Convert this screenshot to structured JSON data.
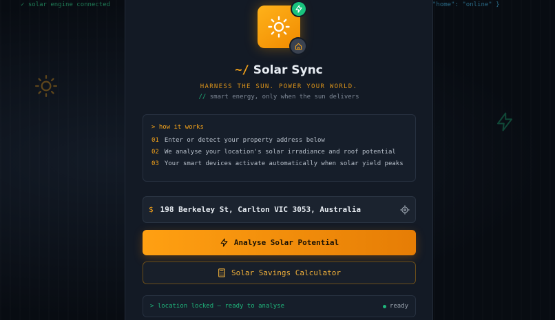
{
  "background": {
    "terminal_left": "✓ solar engine connected",
    "terminal_right": "\"home\": \"online\" }"
  },
  "header": {
    "prompt": "~/",
    "title": "Solar Sync",
    "tagline": "HARNESS THE SUN. POWER YOUR WORLD.",
    "subtag_prefix": "//",
    "subtag": "smart energy, only when the sun delivers"
  },
  "how_it_works": {
    "title": "> how it works",
    "steps": [
      {
        "num": "01",
        "text": "Enter or detect your property address below"
      },
      {
        "num": "02",
        "text": "We analyse your location's solar irradiance and roof potential"
      },
      {
        "num": "03",
        "text": "Your smart devices activate automatically when solar yield peaks"
      }
    ]
  },
  "address": {
    "prefix": "$",
    "value": "198 Berkeley St, Carlton VIC 3053, Australia"
  },
  "actions": {
    "analyse_label": "Analyse Solar Potential",
    "calculator_label": "Solar Savings Calculator"
  },
  "status": {
    "message": "> location locked — ready to analyse",
    "state": "ready"
  },
  "colors": {
    "accent": "#f5a31a",
    "success": "#1fb57b",
    "panel": "#131a25"
  },
  "icons": {
    "logo": "sun-icon",
    "badge_top": "bolt-icon",
    "badge_bottom": "home-icon",
    "locate": "crosshair-icon",
    "analyse": "bolt-icon",
    "calculator": "calculator-icon"
  }
}
